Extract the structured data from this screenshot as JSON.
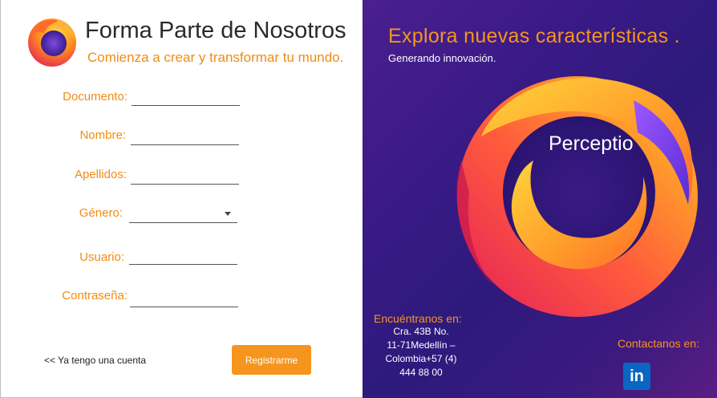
{
  "header": {
    "title": "Forma Parte de Nosotros",
    "subtitle": "Comienza a crear y transformar tu mundo."
  },
  "form": {
    "documento_label": "Documento:",
    "nombre_label": "Nombre:",
    "apellidos_label": "Apellidos:",
    "genero_label": "Género:",
    "genero_value": "",
    "usuario_label": "Usuario:",
    "contrasena_label": "Contraseña:",
    "login_link": "<< Ya tengo una cuenta",
    "register_button": "Registrarme"
  },
  "promo": {
    "title": "Explora nuevas características .",
    "subtitle": "Generando innovación.",
    "brand": "Perceptio",
    "find_label": "Encuéntranos en:",
    "address_line1": "Cra. 43B No.",
    "address_line2": "11-71Medellín –",
    "address_line3": "Colombia+57 (4)",
    "address_line4": "444 88 00",
    "contact_label": "Contactanos en:",
    "linkedin_text": "in"
  },
  "colors": {
    "accent": "#f5951e",
    "panel": "#3a1a86"
  },
  "icons": [
    "firefox-logo-icon",
    "firefox-large-icon",
    "linkedin-icon",
    "dropdown-arrow-icon"
  ]
}
